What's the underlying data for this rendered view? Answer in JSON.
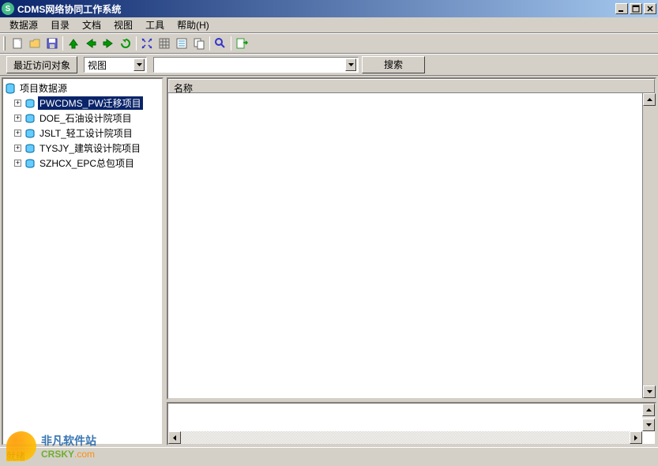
{
  "window": {
    "title": "CDMS网络协同工作系统"
  },
  "menus": {
    "data_source": "数据源",
    "directory": "目录",
    "document": "文档",
    "view": "视图",
    "tools": "工具",
    "help": "帮助(H)"
  },
  "toolbar2": {
    "recent_objects_label": "最近访问对象",
    "view_combo_label": "视图",
    "search_input_value": "",
    "search_button_label": "搜索"
  },
  "tree": {
    "root_label": "项目数据源",
    "items": [
      {
        "label": "PWCDMS_PW迁移项目",
        "selected": true
      },
      {
        "label": "DOE_石油设计院项目",
        "selected": false
      },
      {
        "label": "JSLT_轻工设计院项目",
        "selected": false
      },
      {
        "label": "TYSJY_建筑设计院项目",
        "selected": false
      },
      {
        "label": "SZHCX_EPC总包项目",
        "selected": false
      }
    ]
  },
  "list": {
    "column_name": "名称"
  },
  "statusbar": {
    "text": "就绪"
  },
  "watermark": {
    "line1": "非凡软件站",
    "line2_main": "CRSKY",
    "line2_ext": ".com"
  }
}
